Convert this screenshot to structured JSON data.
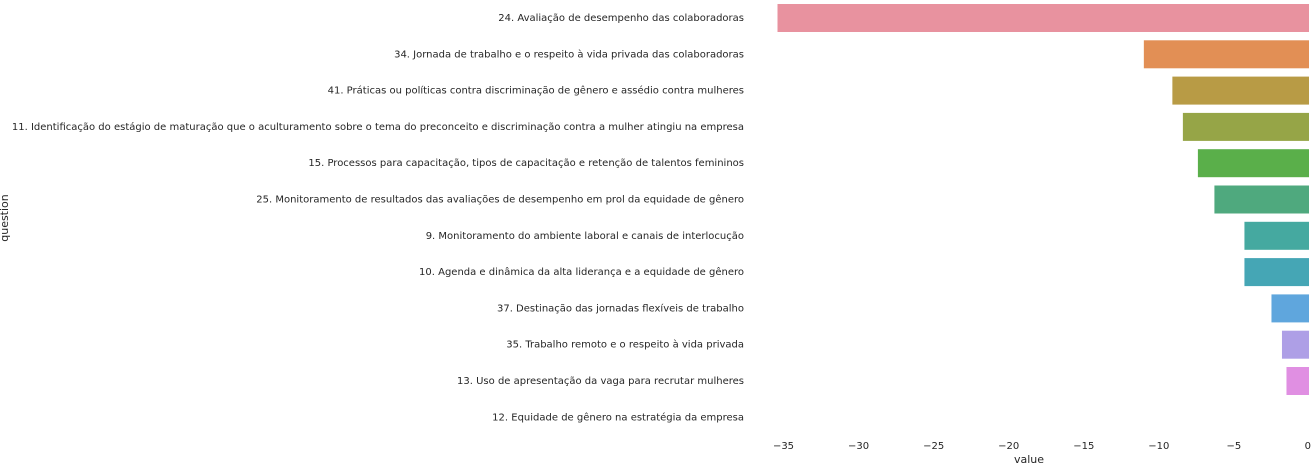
{
  "chart_data": {
    "type": "bar",
    "orientation": "horizontal",
    "xlabel": "value",
    "ylabel": "question",
    "xlim": [
      -35.5,
      0
    ],
    "xticks": [
      -35,
      -30,
      -25,
      -20,
      -15,
      -10,
      -5,
      0
    ],
    "xtick_labels": [
      "−35",
      "−30",
      "−25",
      "−20",
      "−15",
      "−10",
      "−5",
      "0"
    ],
    "grid": false,
    "categories": [
      "24. Avaliação de desempenho das colaboradoras",
      "34. Jornada de trabalho e o respeito à vida privada das colaboradoras",
      "41. Práticas ou políticas contra discriminação de gênero e assédio contra mulheres",
      "11. Identificação do estágio de maturação que o aculturamento sobre o tema do preconceito e discriminação contra a mulher atingiu na empresa",
      "15. Processos para capacitação, tipos de capacitação e retenção de talentos femininos",
      "25. Monitoramento de resultados das avaliações de desempenho em prol da equidade de gênero",
      "9. Monitoramento do ambiente laboral e canais de interlocução",
      "10. Agenda e dinâmica da alta liderança e a equidade de gênero",
      "37. Destinação das jornadas flexíveis de trabalho",
      "35. Trabalho remoto e o respeito à vida privada",
      "13. Uso de apresentação da vaga para recrutar mulheres",
      "12. Equidade de gênero na estratégia da empresa"
    ],
    "values": [
      -35.4,
      -11.0,
      -9.1,
      -8.4,
      -7.4,
      -6.3,
      -4.3,
      -4.3,
      -2.5,
      -1.8,
      -1.5,
      0.0
    ],
    "colors": [
      "#e8929f",
      "#e28f55",
      "#b89b45",
      "#96a547",
      "#5aaf4a",
      "#4fa97e",
      "#45a9a0",
      "#45a6b5",
      "#5fa6dd",
      "#ae9fe6",
      "#e08fe2",
      "#f08fc5"
    ]
  }
}
